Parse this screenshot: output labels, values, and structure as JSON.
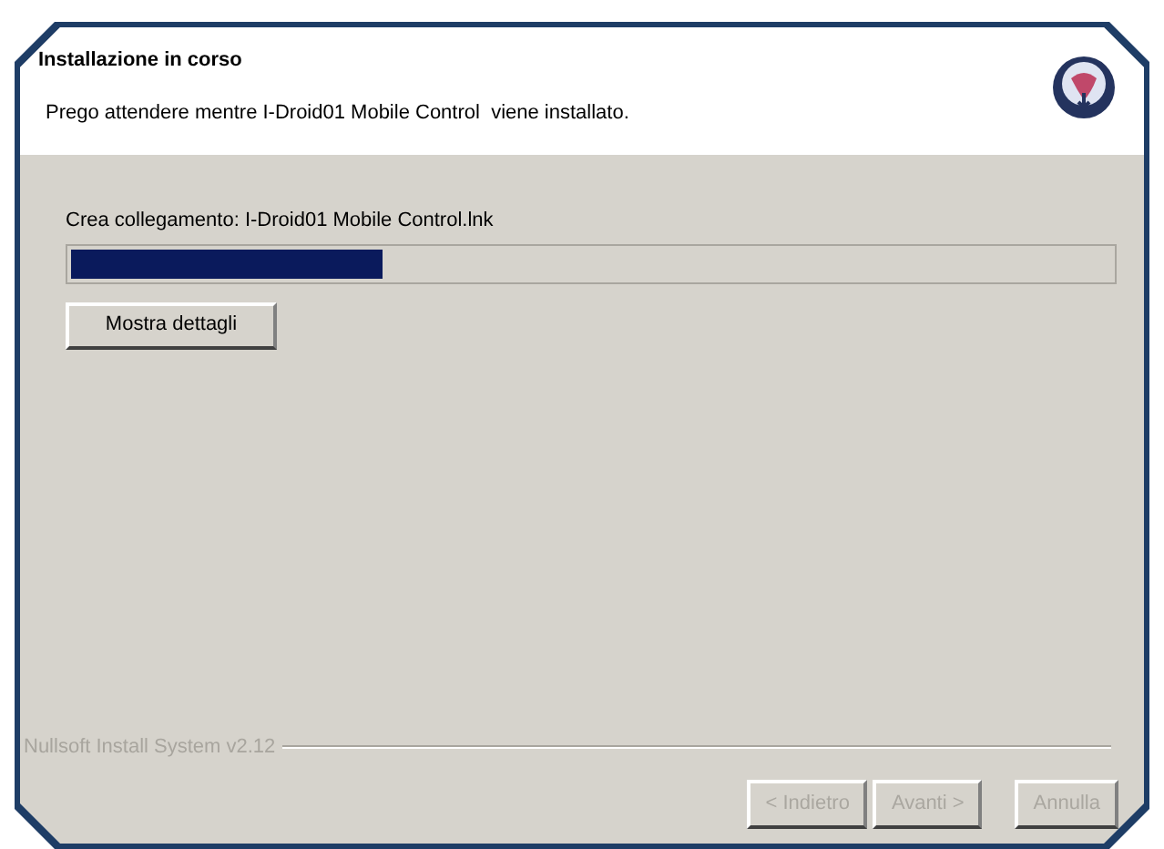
{
  "header": {
    "title": "Installazione in corso",
    "subtitle": "Prego attendere mentre I-Droid01 Mobile Control  viene installato."
  },
  "status_text": "Crea collegamento: I-Droid01 Mobile Control.lnk",
  "progress": {
    "level": 0.3
  },
  "details_button": {
    "label": "Mostra dettagli",
    "disabled": false
  },
  "branding": "Nullsoft Install System v2.12",
  "buttons": [
    {
      "label": "< Indietro",
      "disabled": true
    },
    {
      "label": "Avanti >",
      "disabled": true
    },
    {
      "label": "Annulla",
      "disabled": true
    }
  ]
}
